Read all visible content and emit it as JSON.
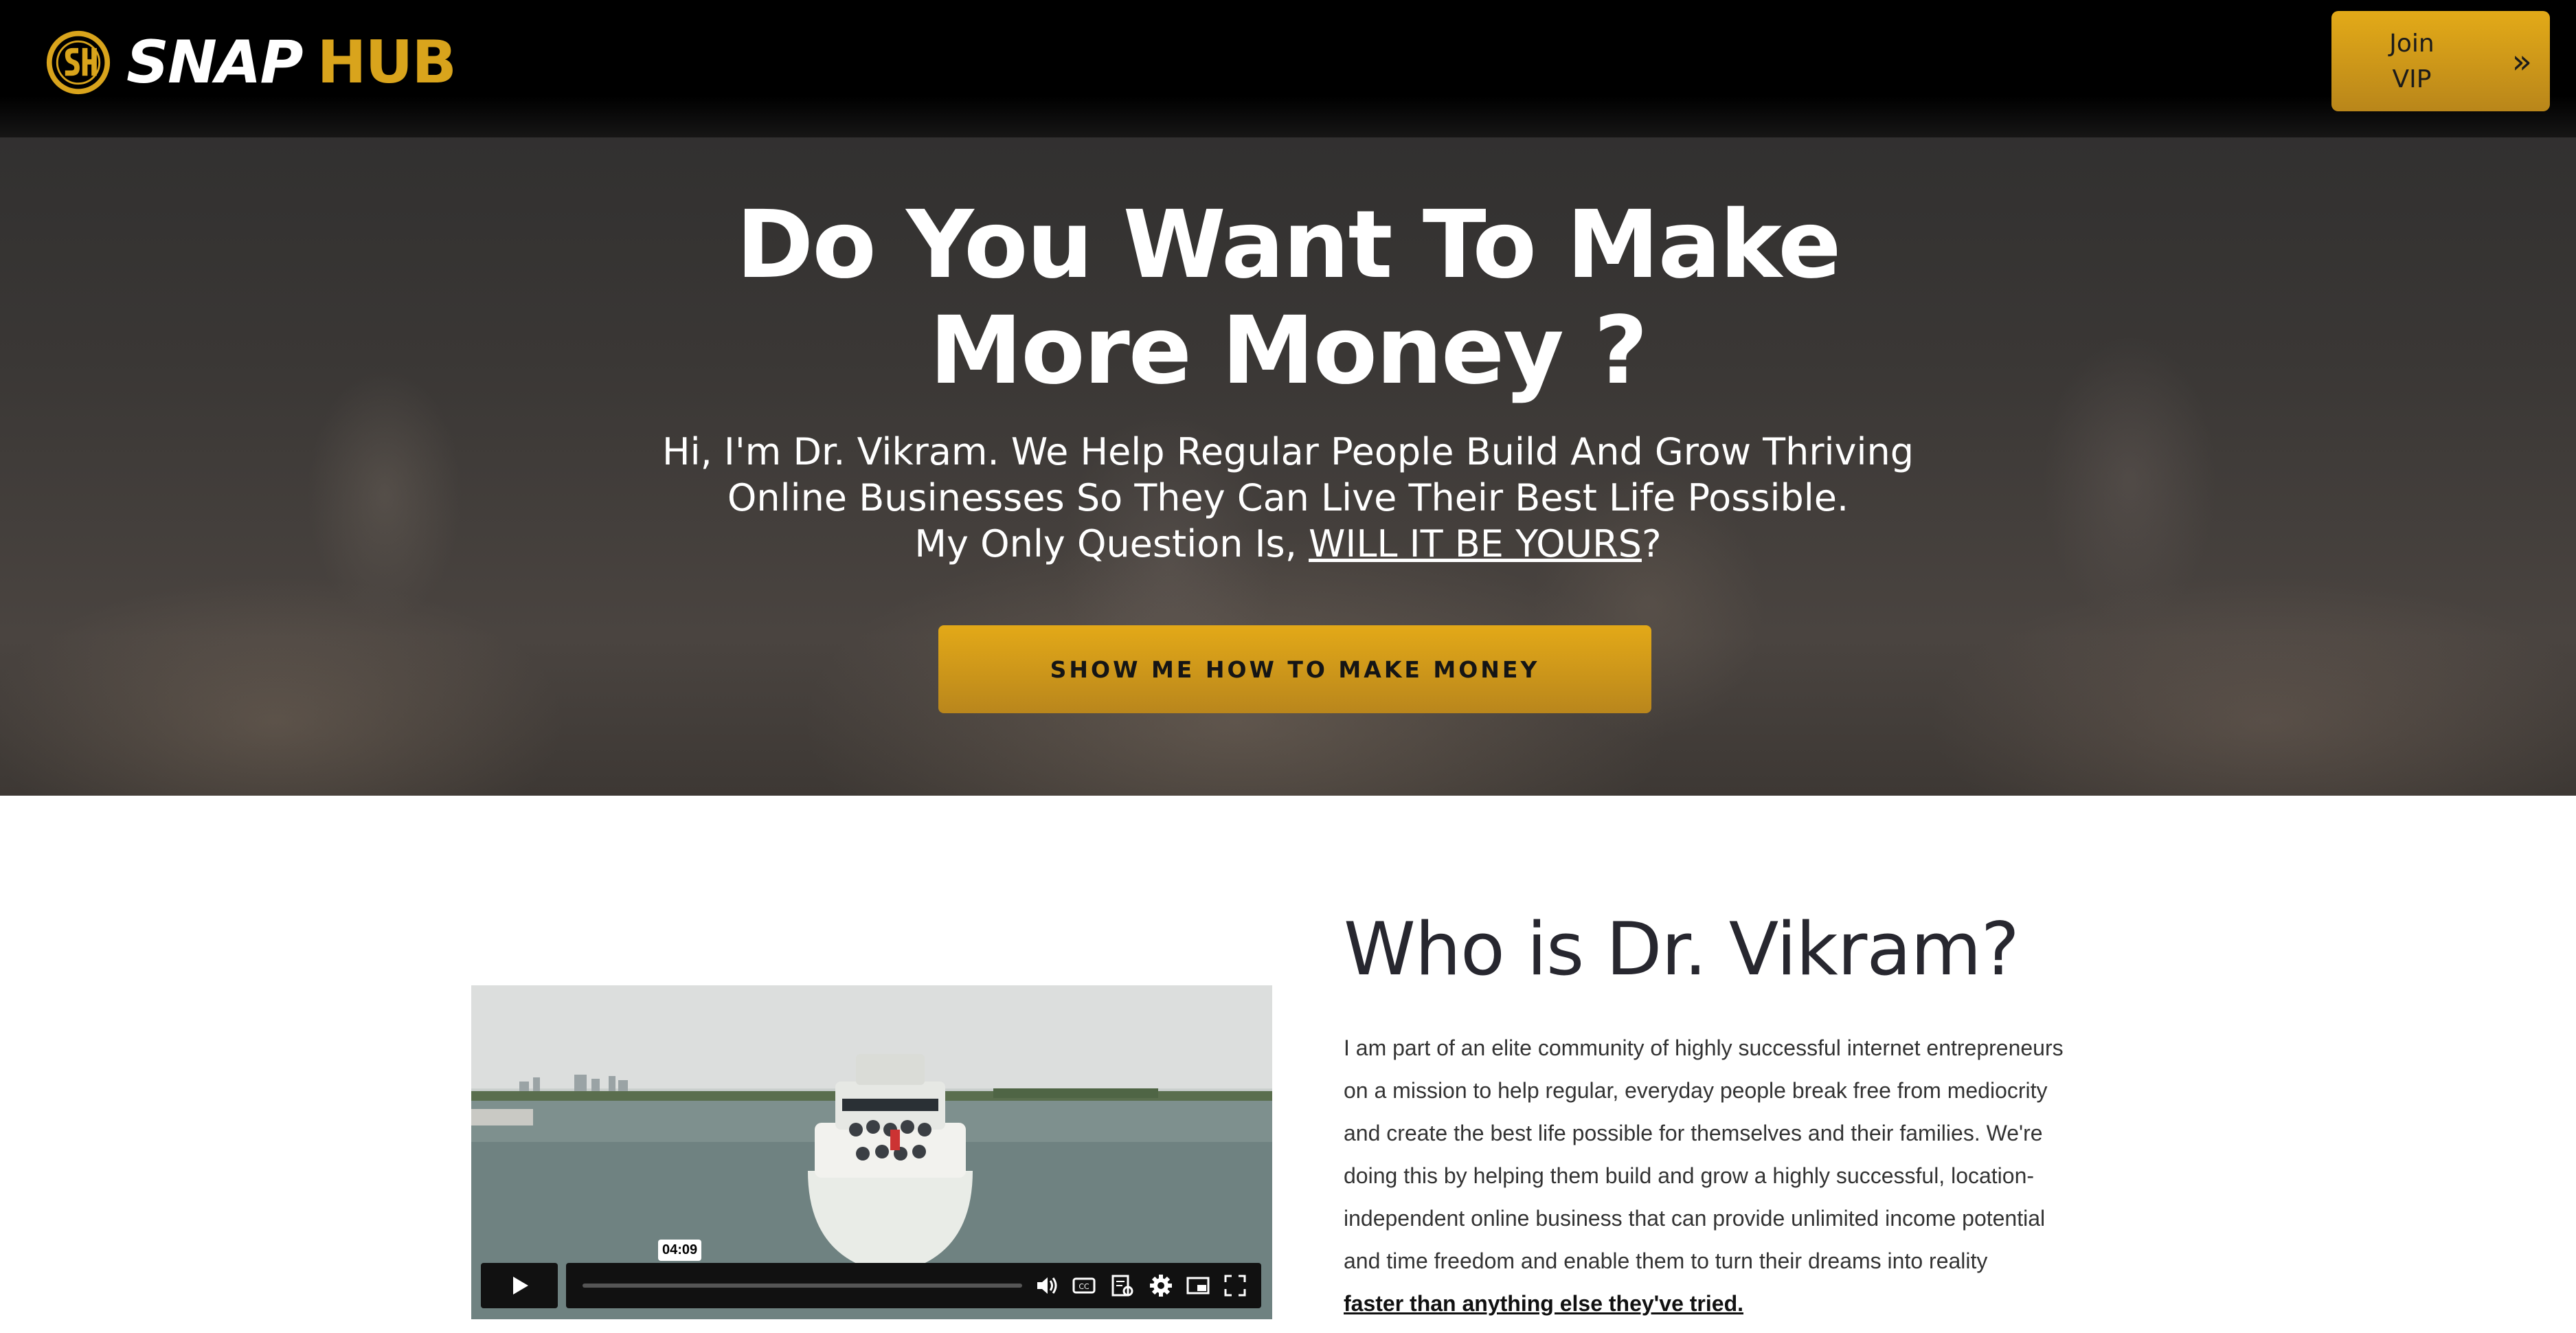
{
  "header": {
    "logo_text_snap": "SNAP",
    "logo_text_hub": "HUB",
    "join_label_line1": "Join",
    "join_label_line2": "VIP",
    "join_icon": "double-chevron-right-icon"
  },
  "hero": {
    "title_line1": "Do You Want To Make",
    "title_line2": "More Money ?",
    "sub_line1": "Hi, I'm Dr. Vikram. We Help Regular People Build And Grow Thriving",
    "sub_line2": "Online Businesses So They Can Live Their Best Life Possible.",
    "sub_line3_prefix": "My Only Question Is, ",
    "sub_line3_link": "WILL IT BE YOURS",
    "sub_line3_suffix": "?",
    "cta_label": "SHOW ME HOW TO MAKE MONEY"
  },
  "video": {
    "time": "04:09",
    "progress": 0,
    "icons": [
      "play-icon",
      "volume-icon",
      "captions-icon",
      "transcript-icon",
      "settings-icon",
      "picture-in-picture-icon",
      "fullscreen-icon"
    ]
  },
  "about": {
    "title": "Who is Dr. Vikram?",
    "line1": "I am part of an elite community of highly successful internet entrepreneurs",
    "line2": "on a mission to help regular, everyday people break free from mediocrity",
    "line3": "and create the best life possible for themselves and their families. We're",
    "line4": "doing this by helping them build and grow a highly successful, location-",
    "line5": "independent online business that can provide unlimited income potential",
    "line6": "and time freedom and enable them to turn their dreams into reality",
    "bold_line": "faster than anything else they've tried."
  },
  "colors": {
    "accent": "#d9a41c",
    "header_bg": "#000000",
    "title_dark": "#27272f"
  }
}
